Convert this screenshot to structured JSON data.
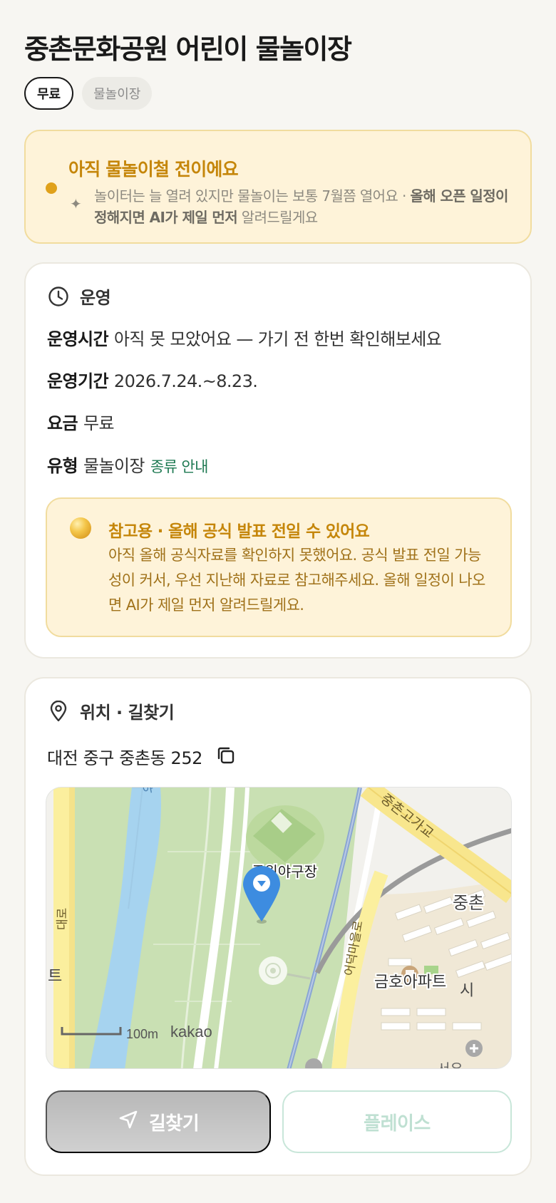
{
  "title": "중촌문화공원 어린이 물놀이장",
  "tags": {
    "price": "무료",
    "type": "물놀이장"
  },
  "notice": {
    "title": "아직 물놀이철 전이에요",
    "body_part1": "놀이터는 늘 열려 있지만 물놀이는 보통 7월쯤 열어요 · ",
    "body_bold": "올해 오픈 일정이 정해지면 AI가 제일 먼저",
    "body_part2": " 알려드릴게요"
  },
  "operation": {
    "section_label": "운영",
    "hours_key": "운영시간",
    "hours_value": "아직 못 모았어요 — 가기 전 한번 확인해보세요",
    "period_key": "운영기간",
    "period_value": "2026.7.24.~8.23.",
    "fee_key": "요금",
    "fee_value": "무료",
    "type_key": "유형",
    "type_value": "물놀이장",
    "type_link": "종류 안내",
    "reference": {
      "title": "참고용 · 올해 공식 발표 전일 수 있어요",
      "body": "아직 올해 공식자료를 확인하지 못했어요. 공식 발표 전일 가능성이 커서, 우선 지난해 자료로 참고해주세요. 올해 일정이 나오면 AI가 제일 먼저 알려드릴게요."
    }
  },
  "location": {
    "section_label": "위치 · 길찾기",
    "address": "대전 중구 중촌동 252",
    "map": {
      "labels": {
        "baseball": "공원야구장",
        "apartment": "금호아파트",
        "road_top": "중촌고가교",
        "road_right": "어덕마을로",
        "district": "중촌",
        "district_cut": "시",
        "left_road": "대로",
        "left_edge": "트",
        "top_stub": "야",
        "bottom_right": "서우"
      },
      "scale": "100m",
      "logo": "kakao"
    },
    "directions_label": "길찾기",
    "places_label": "플레이스"
  },
  "colors": {
    "accent_orange": "#c5860a",
    "notice_bg": "#fef3d9",
    "link_green": "#1f7a53",
    "pin_blue": "#3d8ce0"
  }
}
